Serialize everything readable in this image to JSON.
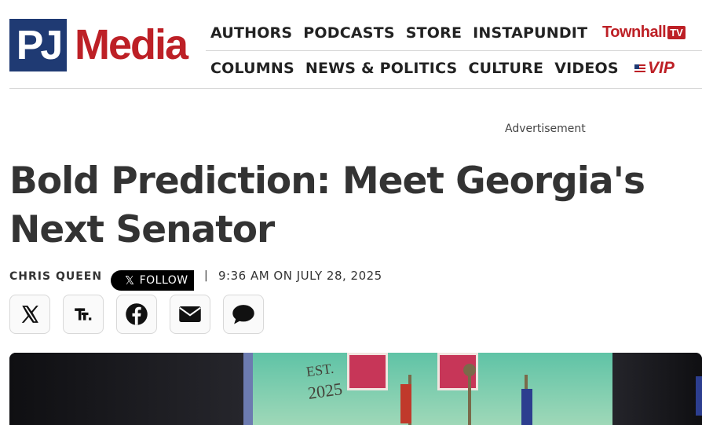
{
  "site": {
    "logo_mark": "PJ",
    "logo_word": "Media"
  },
  "nav": {
    "top": [
      "AUTHORS",
      "PODCASTS",
      "STORE",
      "INSTAPUNDIT"
    ],
    "bottom": [
      "COLUMNS",
      "NEWS & POLITICS",
      "CULTURE",
      "VIDEOS"
    ],
    "townhall_label": "Townhall",
    "townhall_tv": "TV",
    "vip_label": "VIP"
  },
  "ad": {
    "label": "Advertisement"
  },
  "article": {
    "title": "Bold Prediction: Meet Georgia's Next Senator",
    "author": "CHRIS QUEEN",
    "follow_label": "FOLLOW",
    "separator": "|",
    "timestamp": "9:36 AM ON JULY 28, 2025"
  },
  "share_buttons": [
    {
      "icon": "x-icon"
    },
    {
      "icon": "truth-social-icon"
    },
    {
      "icon": "facebook-icon"
    },
    {
      "icon": "email-icon"
    },
    {
      "icon": "comment-icon"
    }
  ],
  "hero_image": {
    "sign_text_1": "EST.",
    "sign_text_2": "2025"
  },
  "colors": {
    "brand_blue": "#1f3a73",
    "brand_red": "#bd2026",
    "text_dark": "#333333"
  }
}
